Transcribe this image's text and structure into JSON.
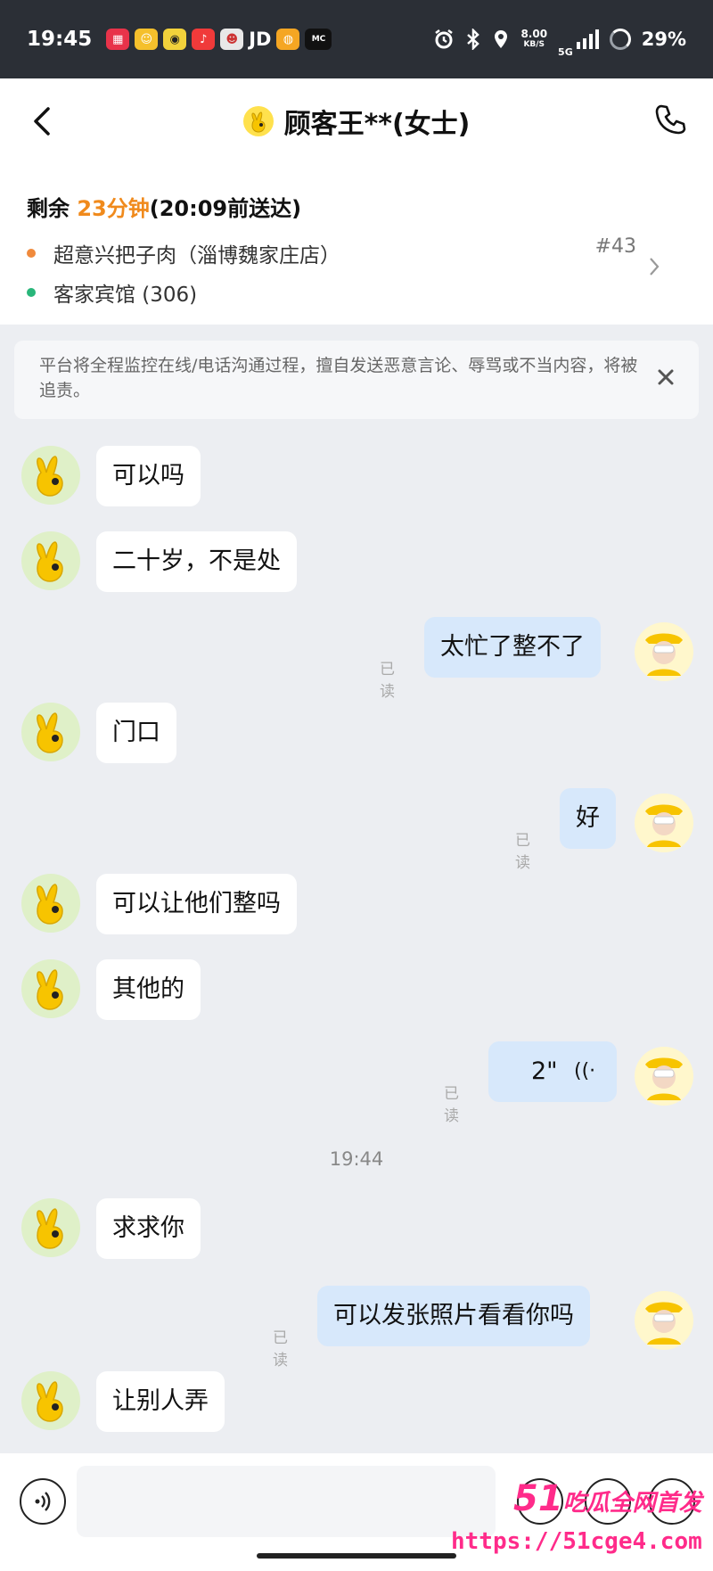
{
  "status_bar": {
    "time": "19:45",
    "app_icons": [
      "app-red-grid",
      "app-yellow-smile",
      "app-yellow-cat",
      "app-music",
      "app-cartoon",
      "JD",
      "weibo",
      "mcall"
    ],
    "jd_label": "JD",
    "net_speed_value": "8.00",
    "net_speed_unit": "KB/S",
    "network": "5G",
    "battery": "29%"
  },
  "header": {
    "title": "顾客王**(女士)"
  },
  "order": {
    "remain_prefix": "剩余 ",
    "remain_minutes": "23分钟",
    "remain_suffix": "(20:09前送达)",
    "pickup": "超意兴把子肉（淄博魏家庄店）",
    "dropoff": "客家宾馆 (306)",
    "order_number": "#43",
    "colors": {
      "pickup_dot": "#f08a3c",
      "dropoff_dot": "#29b67a",
      "accent": "#f08a1c"
    }
  },
  "notice": {
    "text": "平台将全程监控在线/电话沟通过程，擅自发送恶意言论、辱骂或不当内容，将被追责。"
  },
  "messages": [
    {
      "from": "customer",
      "text": "可以吗"
    },
    {
      "from": "customer",
      "text": "二十岁，不是处"
    },
    {
      "from": "me",
      "text": "太忙了整不了",
      "status": "已读"
    },
    {
      "from": "customer",
      "text": "门口"
    },
    {
      "from": "me",
      "text": "好",
      "status": "已读"
    },
    {
      "from": "customer",
      "text": "可以让他们整吗"
    },
    {
      "from": "customer",
      "text": "其他的"
    },
    {
      "from": "me",
      "type": "voice",
      "text": "2\"",
      "status": "已读"
    },
    {
      "from": "system",
      "type": "time",
      "text": "19:44"
    },
    {
      "from": "customer",
      "text": "求求你"
    },
    {
      "from": "me",
      "text": "可以发张照片看看你吗",
      "status": "已读"
    },
    {
      "from": "customer",
      "text": "让别人弄"
    }
  ],
  "input_bar": {
    "placeholder": ""
  },
  "watermark": {
    "line1_num": "51",
    "line1_text": "吃瓜全网首发",
    "line2": "https://51cge4.com"
  }
}
